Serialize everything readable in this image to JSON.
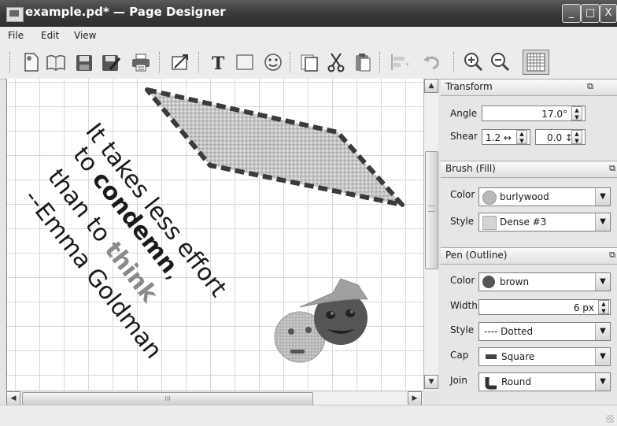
{
  "window": {
    "title": "example.pd* — Page Designer",
    "controls": [
      "_",
      "□",
      "X"
    ]
  },
  "menu": [
    {
      "label": "File"
    },
    {
      "label": "Edit"
    },
    {
      "label": "View"
    }
  ],
  "toolbar": {
    "icons": [
      "new-page-icon",
      "open-book-icon",
      "save-icon",
      "save-as-icon",
      "print-icon",
      "resize-icon",
      "text-icon",
      "rectangle-icon",
      "smiley-icon",
      "copy-icon",
      "cut-icon",
      "paste-icon",
      "align-icon",
      "undo-icon",
      "zoom-in-icon",
      "zoom-out-icon",
      "grid-icon"
    ]
  },
  "canvas": {
    "quote": {
      "line1": "It takes less effort",
      "line2_pre": "to ",
      "line2_bold": "condemn",
      "line2_post": ",",
      "line3_pre": "than to ",
      "line3_bold": "think",
      "line4": "--Emma Goldman"
    },
    "shapes": [
      "parallelogram-shape",
      "smiley-face",
      "smiley-face-with-hat"
    ],
    "colors": {
      "parallelogram_fill": "#bdbdbd",
      "parallelogram_outline": "#3a3a3a",
      "grid": "#d8d8d8",
      "think_color": "#8a8a8a"
    }
  },
  "panels": {
    "transform": {
      "title": "Transform",
      "angle_label": "Angle",
      "angle_value": "17.0°",
      "shear_label": "Shear",
      "shear_x": "1.2 ↔",
      "shear_y": "0.0 ↕"
    },
    "brush": {
      "title": "Brush (Fill)",
      "color_label": "Color",
      "color_value": "burlywood",
      "style_label": "Style",
      "style_value": "Dense #3"
    },
    "pen": {
      "title": "Pen (Outline)",
      "color_label": "Color",
      "color_value": "brown",
      "width_label": "Width",
      "width_value": "6 px",
      "style_label": "Style",
      "style_value": "---- Dotted",
      "cap_label": "Cap",
      "cap_value": "Square",
      "join_label": "Join",
      "join_value": "Round"
    }
  },
  "scrollbars": {
    "up": "▲",
    "down": "▼",
    "left": "◀",
    "right": "▶",
    "grip": "III"
  }
}
